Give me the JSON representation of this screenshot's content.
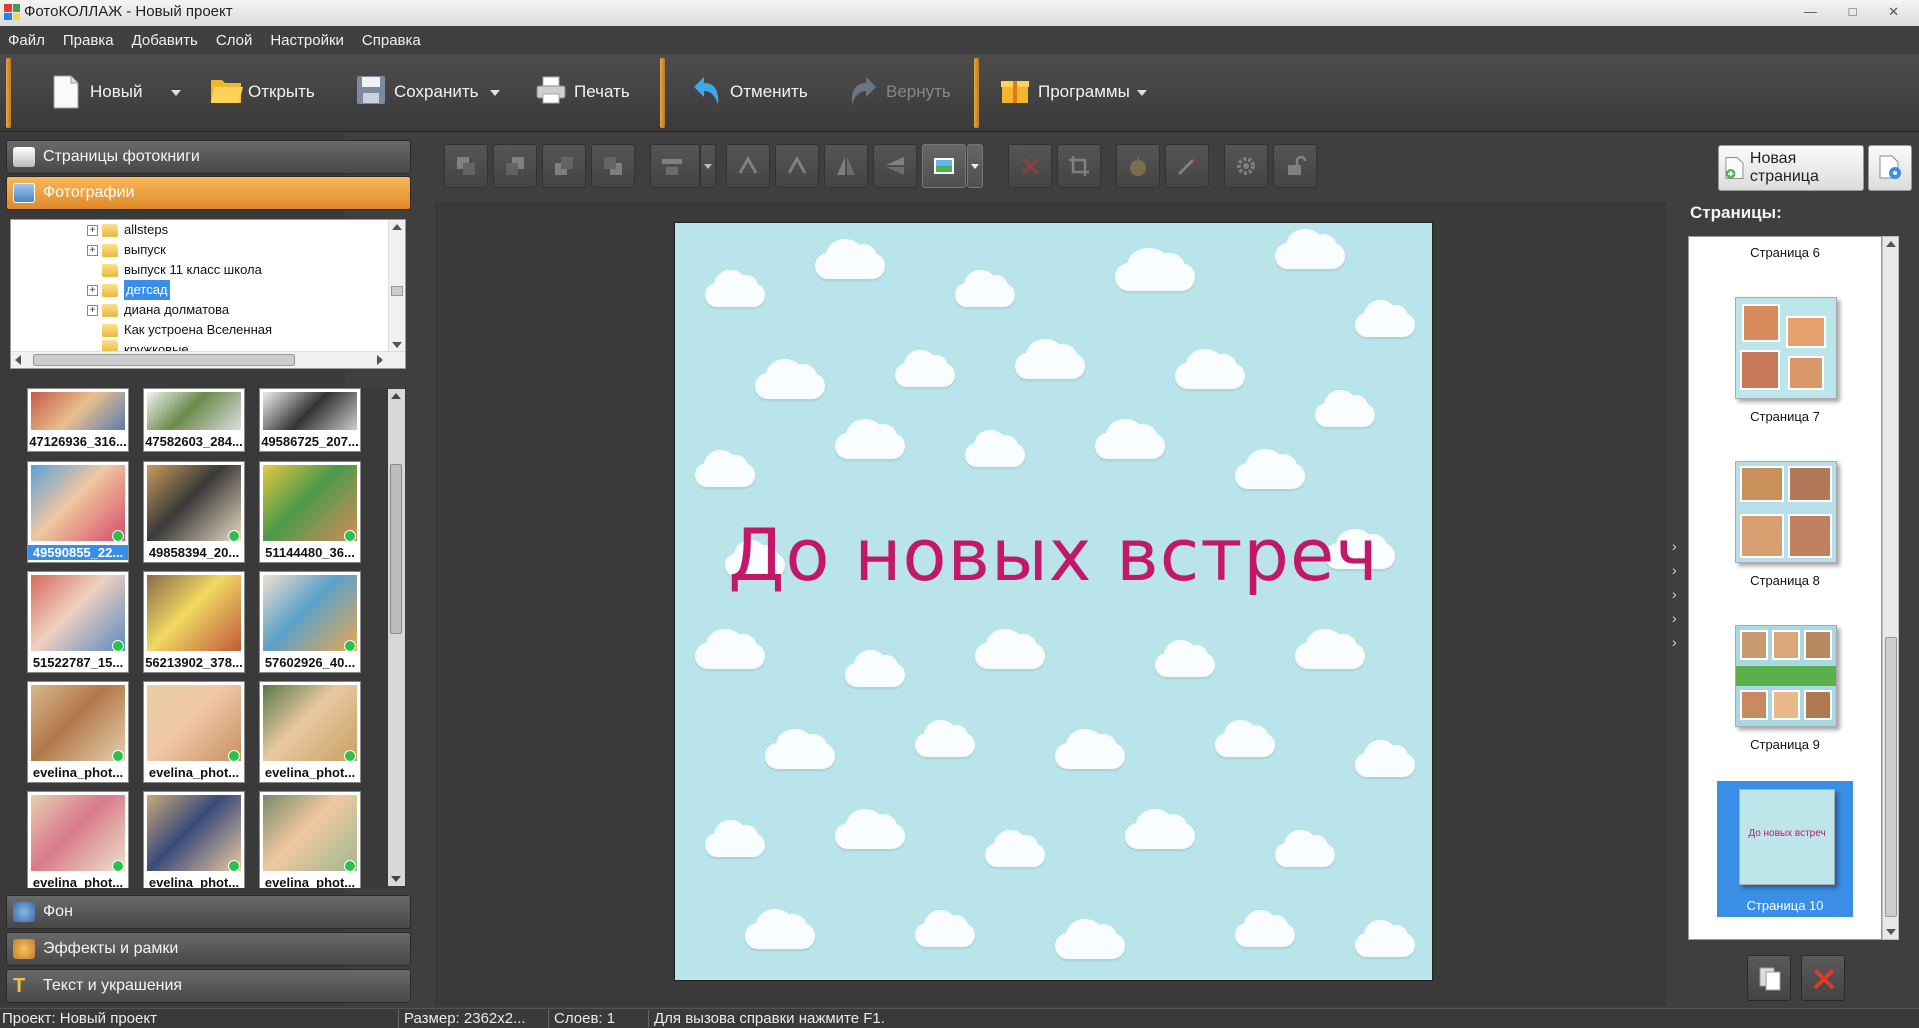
{
  "window": {
    "title": "ФотоКОЛЛАЖ - Новый проект"
  },
  "menu": [
    "Файл",
    "Правка",
    "Добавить",
    "Слой",
    "Настройки",
    "Справка"
  ],
  "toolbar": {
    "new_label": "Новый",
    "open_label": "Открыть",
    "save_label": "Сохранить",
    "print_label": "Печать",
    "undo_label": "Отменить",
    "redo_label": "Вернуть",
    "programs_label": "Программы"
  },
  "left_panel": {
    "section_pages": "Страницы фотокниги",
    "section_photos": "Фотографии",
    "section_background": "Фон",
    "section_effects": "Эффекты и рамки",
    "section_text": "Текст и украшения",
    "tree": [
      {
        "label": "allsteps",
        "expandable": true
      },
      {
        "label": "выпуск",
        "expandable": true
      },
      {
        "label": "выпуск 11 класс школа",
        "expandable": false
      },
      {
        "label": "детсад",
        "expandable": true,
        "selected": true
      },
      {
        "label": "диана долматова",
        "expandable": true
      },
      {
        "label": "Как устроена Вселенная",
        "expandable": false
      },
      {
        "label": "кружковые",
        "expandable": false
      }
    ],
    "thumbnails": [
      {
        "caption": "47126936_316...",
        "checked": false
      },
      {
        "caption": "47582603_284...",
        "checked": false
      },
      {
        "caption": "49586725_207...",
        "checked": false
      },
      {
        "caption": "49590855_22...",
        "checked": true,
        "selected": true
      },
      {
        "caption": "49858394_20...",
        "checked": true
      },
      {
        "caption": "51144480_36...",
        "checked": true
      },
      {
        "caption": "51522787_15...",
        "checked": true
      },
      {
        "caption": "56213902_378...",
        "checked": false
      },
      {
        "caption": "57602926_40...",
        "checked": true
      },
      {
        "caption": "evelina_phot...",
        "checked": true
      },
      {
        "caption": "evelina_phot...",
        "checked": true
      },
      {
        "caption": "evelina_phot...",
        "checked": true
      },
      {
        "caption": "evelina_phot...",
        "checked": true
      },
      {
        "caption": "evelina_phot...",
        "checked": true
      },
      {
        "caption": "evelina_phot...",
        "checked": true
      }
    ]
  },
  "canvas": {
    "page_text": "До новых встреч"
  },
  "right_panel": {
    "new_page_label": "Новая страница",
    "pages_title": "Страницы:",
    "pages": [
      {
        "label": "Страница 6"
      },
      {
        "label": "Страница 7"
      },
      {
        "label": "Страница 8"
      },
      {
        "label": "Страница 9"
      },
      {
        "label": "Страница 10",
        "selected": true
      }
    ],
    "selected_thumb_text": "До новых встреч"
  },
  "statusbar": {
    "project": "Проект:  Новый проект",
    "size": "Размер:  2362x2...",
    "layers": "Слоев:  1",
    "hint": "Для вызова справки нажмите F1."
  },
  "colors": {
    "accent": "#e8a640",
    "selection": "#3a8ee6",
    "page_text": "#c2176b",
    "page_bg": "#b8e4ea"
  }
}
